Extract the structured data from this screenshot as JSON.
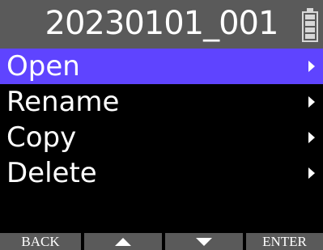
{
  "title": "20230101_001",
  "battery_icon": "battery-full-icon",
  "menu": [
    {
      "label": "Open",
      "selected": true,
      "arrow_icon": "chevron-right-icon"
    },
    {
      "label": "Rename",
      "selected": false,
      "arrow_icon": "chevron-right-icon"
    },
    {
      "label": "Copy",
      "selected": false,
      "arrow_icon": "chevron-right-icon"
    },
    {
      "label": "Delete",
      "selected": false,
      "arrow_icon": "chevron-right-icon"
    }
  ],
  "softkeys": {
    "back_label": "BACK",
    "up_icon": "triangle-up-icon",
    "down_icon": "triangle-down-icon",
    "enter_label": "ENTER"
  },
  "colors": {
    "title_bar": "#5a5a5a",
    "selection": "#5f44ff",
    "background": "#000000",
    "text": "#ffffff"
  }
}
